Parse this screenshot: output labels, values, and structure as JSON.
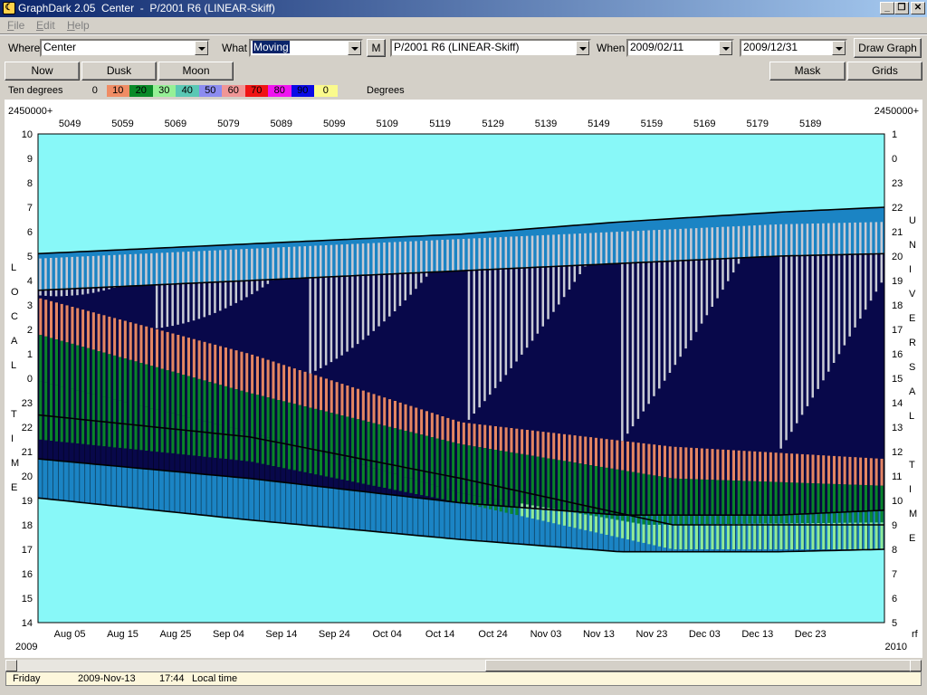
{
  "window": {
    "title": "GraphDark 2.05  Center  -  P/2001 R6 (LINEAR-Skiff)",
    "minimize_glyph": "_",
    "restore_glyph": "❐",
    "close_glyph": "✕"
  },
  "menu": [
    {
      "first": "F",
      "rest": "ile"
    },
    {
      "first": "E",
      "rest": "dit"
    },
    {
      "first": "H",
      "rest": "elp"
    }
  ],
  "toolbar": {
    "where_label": "Where",
    "where_value": "Center",
    "what_label": "What",
    "what_value": "Moving",
    "m_button": "M",
    "object_value": "P/2001 R6 (LINEAR-Skiff)",
    "when_label": "When",
    "start_date": "2009/02/11",
    "end_date": "2009/12/31",
    "draw_graph": "Draw Graph"
  },
  "buttons": {
    "now": "Now",
    "dusk": "Dusk",
    "moon": "Moon",
    "mask": "Mask",
    "grids": "Grids"
  },
  "legend": {
    "label": "Ten degrees",
    "unit": "Degrees",
    "bins": [
      {
        "label": "0",
        "color": "#d4d0c8"
      },
      {
        "label": "10",
        "color": "#f08c64"
      },
      {
        "label": "20",
        "color": "#0a8a28"
      },
      {
        "label": "30",
        "color": "#96f096"
      },
      {
        "label": "40",
        "color": "#5ac8b4"
      },
      {
        "label": "50",
        "color": "#8c8cf0"
      },
      {
        "label": "60",
        "color": "#f09696"
      },
      {
        "label": "70",
        "color": "#f01414"
      },
      {
        "label": "80",
        "color": "#f014f0"
      },
      {
        "label": "90",
        "color": "#0a0ae6"
      },
      {
        "label": "0",
        "color": "#fafa8c"
      }
    ]
  },
  "chart_data": {
    "type": "heatmap",
    "jd_prefix_left": "2450000+",
    "jd_prefix_right": "2450000+",
    "jd_ticks": [
      "5049",
      "5059",
      "5069",
      "5079",
      "5089",
      "5099",
      "5109",
      "5119",
      "5129",
      "5139",
      "5149",
      "5159",
      "5169",
      "5179",
      "5189"
    ],
    "date_ticks": [
      "Aug 05",
      "Aug 15",
      "Aug 25",
      "Sep 04",
      "Sep 14",
      "Sep 24",
      "Oct 04",
      "Oct 14",
      "Oct 24",
      "Nov 03",
      "Nov 13",
      "Nov 23",
      "Dec 03",
      "Dec 13",
      "Dec 23"
    ],
    "year_left": "2009",
    "year_right": "2010",
    "left_axis_ticks": [
      "10",
      "9",
      "8",
      "7",
      "6",
      "5",
      "4",
      "3",
      "2",
      "1",
      "0",
      "23",
      "22",
      "21",
      "20",
      "19",
      "18",
      "17",
      "16",
      "15",
      "14"
    ],
    "right_axis_ticks": [
      "1",
      "0",
      "23",
      "22",
      "21",
      "20",
      "19",
      "18",
      "17",
      "16",
      "15",
      "14",
      "13",
      "12",
      "11",
      "10",
      "9",
      "8",
      "7",
      "6",
      "5"
    ],
    "left_axis_label": [
      "L",
      "O",
      "C",
      "A",
      "L",
      "",
      "T",
      "I",
      "M",
      "E"
    ],
    "right_axis_label": [
      "U",
      "N",
      "I",
      "V",
      "E",
      "R",
      "S",
      "A",
      "L",
      "",
      "T",
      "I",
      "M",
      "E"
    ],
    "right_corner": "rf",
    "x_range_jd": [
      2455043,
      2455203
    ],
    "local_hour_range": [
      14,
      34
    ],
    "colors": {
      "daylight": "#88f8f8",
      "twilight": "#1b84c4",
      "night": "#08084a",
      "below_horizon": "#c8cad4",
      "alt_10": "#f08c64",
      "alt_20": "#0a8a28",
      "alt_30": "#96f096"
    },
    "boundaries_local_hours": {
      "sunset": [
        [
          2455043,
          19.1
        ],
        [
          2455083,
          18.2
        ],
        [
          2455123,
          17.4
        ],
        [
          2455153,
          16.9
        ],
        [
          2455183,
          16.9
        ],
        [
          2455203,
          17.0
        ]
      ],
      "dusk_end": [
        [
          2455043,
          20.7
        ],
        [
          2455083,
          19.9
        ],
        [
          2455123,
          18.9
        ],
        [
          2455153,
          18.4
        ],
        [
          2455183,
          18.4
        ],
        [
          2455203,
          18.6
        ]
      ],
      "dawn_start": [
        [
          2455043,
          27.6
        ],
        [
          2455083,
          28.0
        ],
        [
          2455123,
          28.4
        ],
        [
          2455153,
          28.7
        ],
        [
          2455183,
          29.0
        ],
        [
          2455203,
          29.1
        ]
      ],
      "sunrise": [
        [
          2455043,
          29.1
        ],
        [
          2455083,
          29.5
        ],
        [
          2455123,
          29.9
        ],
        [
          2455153,
          30.4
        ],
        [
          2455183,
          30.8
        ],
        [
          2455203,
          31.0
        ]
      ]
    },
    "object_altitude_bands_local_hours": {
      "alt_10_top": [
        [
          2455043,
          27.3
        ],
        [
          2455083,
          25.0
        ],
        [
          2455123,
          22.2
        ],
        [
          2455163,
          21.2
        ],
        [
          2455203,
          20.7
        ]
      ],
      "alt_20_top": [
        [
          2455043,
          25.8
        ],
        [
          2455083,
          23.4
        ],
        [
          2455123,
          21.3
        ],
        [
          2455163,
          19.9
        ],
        [
          2455203,
          19.6
        ]
      ],
      "alt_30_top": [
        [
          2455043,
          23.9
        ],
        [
          2455083,
          21.8
        ],
        [
          2455123,
          19.3
        ],
        [
          2455158,
          18.0
        ],
        [
          2455203,
          18.1
        ]
      ],
      "alt_20_bottom": [
        [
          2455043,
          21.5
        ],
        [
          2455083,
          20.6
        ],
        [
          2455123,
          18.9
        ],
        [
          2455163,
          17.0
        ],
        [
          2455203,
          17.0
        ]
      ]
    }
  },
  "status": {
    "day": "Friday",
    "date": "2009-Nov-13",
    "time": "17:44",
    "zone": "Local time"
  }
}
